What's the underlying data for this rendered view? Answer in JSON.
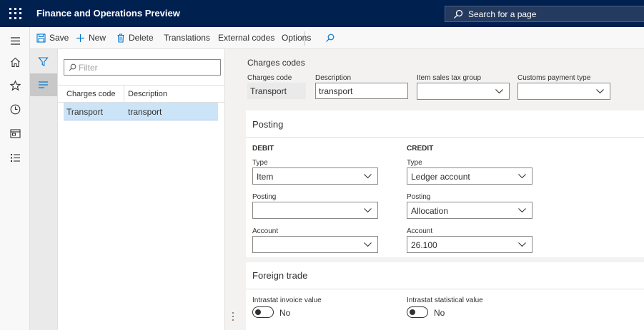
{
  "app": {
    "title": "Finance and Operations Preview",
    "search_placeholder": "Search for a page"
  },
  "actions": {
    "save": "Save",
    "new": "New",
    "delete": "Delete",
    "translations": "Translations",
    "external_codes": "External codes",
    "options": "Options"
  },
  "list": {
    "filter_placeholder": "Filter",
    "columns": [
      "Charges code",
      "Description"
    ],
    "rows": [
      {
        "code": "Transport",
        "description": "transport"
      }
    ]
  },
  "details": {
    "caption": "Charges codes",
    "header": {
      "charges_code_label": "Charges code",
      "charges_code_value": "Transport",
      "description_label": "Description",
      "description_value": "transport",
      "item_sales_tax_group_label": "Item sales tax group",
      "item_sales_tax_group_value": "",
      "customs_payment_type_label": "Customs payment type",
      "customs_payment_type_value": ""
    },
    "posting": {
      "title": "Posting",
      "debit": {
        "heading": "DEBIT",
        "type_label": "Type",
        "type_value": "Item",
        "posting_label": "Posting",
        "posting_value": "",
        "account_label": "Account",
        "account_value": ""
      },
      "credit": {
        "heading": "CREDIT",
        "type_label": "Type",
        "type_value": "Ledger account",
        "posting_label": "Posting",
        "posting_value": "Allocation",
        "account_label": "Account",
        "account_value": "26.100"
      }
    },
    "foreign_trade": {
      "title": "Foreign trade",
      "intrastat_invoice_label": "Intrastat invoice value",
      "intrastat_invoice_value": "No",
      "intrastat_statistical_label": "Intrastat statistical value",
      "intrastat_statistical_value": "No"
    }
  },
  "colors": {
    "topbar": "#002050",
    "selection": "#cce4f7",
    "accent": "#0078d4"
  }
}
